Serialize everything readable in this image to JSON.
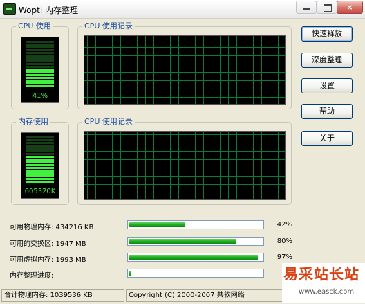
{
  "window": {
    "title": "Wopti 内存整理",
    "min_glyph": "_",
    "max_glyph": "□",
    "close_glyph": "×"
  },
  "cpu_group": {
    "label": "CPU 使用",
    "value_text": "41%",
    "level": 0.41
  },
  "cpu_history": {
    "label": "CPU 使用记录"
  },
  "mem_group": {
    "label": "内存使用",
    "value_text": "605320K",
    "level": 0.58
  },
  "mem_history": {
    "label": "CPU 使用记录"
  },
  "buttons": {
    "quick_release": "快速释放",
    "deep_clean": "深度整理",
    "settings": "设置",
    "help": "帮助",
    "about": "关于"
  },
  "stats": [
    {
      "label": "可用物理内存: 434216 KB",
      "percent_text": "42%",
      "fraction": 0.42
    },
    {
      "label": "可用的交换区: 1947 MB",
      "percent_text": "80%",
      "fraction": 0.8
    },
    {
      "label": "可用虚拟内存: 1993 MB",
      "percent_text": "97%",
      "fraction": 0.97
    },
    {
      "label": "内存整理进度:",
      "percent_text": "",
      "fraction": 0.01
    }
  ],
  "statusbar": {
    "total_memory": "合计物理内存: 1039536 KB",
    "copyright": "Copyright (C) 2000-2007 共软网络"
  },
  "watermark": {
    "text": "易采站长站",
    "url": "www.easck.com"
  },
  "colors": {
    "meter_on": "#41f041",
    "meter_off": "#173f17",
    "grid_line": "#0a7a3a",
    "group_label": "#1f4fa3",
    "progress_fill": "#1bab1b"
  }
}
